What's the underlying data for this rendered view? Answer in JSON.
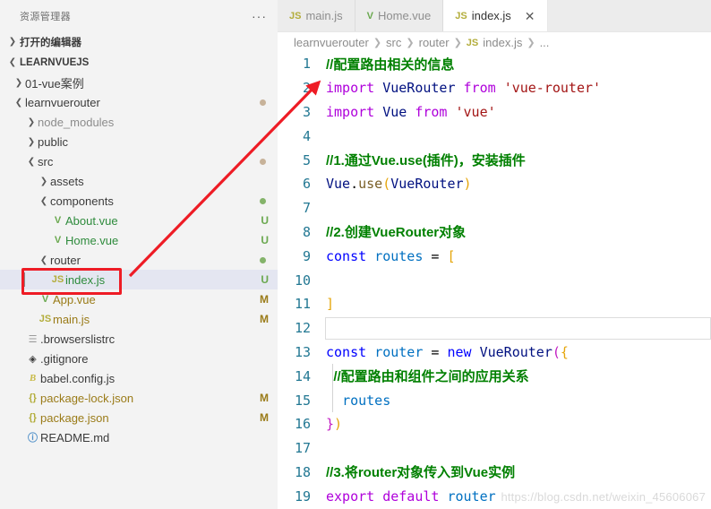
{
  "sidebar": {
    "header_title": "资源管理器",
    "more_actions": "···",
    "open_editors_label": "打开的编辑器",
    "root_label": "LEARNVUEJS",
    "tree": [
      {
        "label": "01-vue案例",
        "depth": 1,
        "type": "folder",
        "expanded": false,
        "color": "plain",
        "status": "",
        "dot": ""
      },
      {
        "label": "learnvuerouter",
        "depth": 1,
        "type": "folder",
        "expanded": true,
        "color": "plain",
        "status": "",
        "dot": "tan"
      },
      {
        "label": "node_modules",
        "depth": 2,
        "type": "folder",
        "expanded": false,
        "color": "grey",
        "status": "",
        "dot": ""
      },
      {
        "label": "public",
        "depth": 2,
        "type": "folder",
        "expanded": false,
        "color": "plain",
        "status": "",
        "dot": ""
      },
      {
        "label": "src",
        "depth": 2,
        "type": "folder",
        "expanded": true,
        "color": "plain",
        "status": "",
        "dot": "tan"
      },
      {
        "label": "assets",
        "depth": 3,
        "type": "folder",
        "expanded": false,
        "color": "plain",
        "status": "",
        "dot": ""
      },
      {
        "label": "components",
        "depth": 3,
        "type": "folder",
        "expanded": true,
        "color": "plain",
        "status": "",
        "dot": "green"
      },
      {
        "label": "About.vue",
        "depth": 4,
        "type": "vue",
        "expanded": null,
        "color": "green",
        "status": "U",
        "dot": ""
      },
      {
        "label": "Home.vue",
        "depth": 4,
        "type": "vue",
        "expanded": null,
        "color": "green",
        "status": "U",
        "dot": ""
      },
      {
        "label": "router",
        "depth": 3,
        "type": "folder",
        "expanded": true,
        "color": "plain",
        "status": "",
        "dot": "green"
      },
      {
        "label": "index.js",
        "depth": 4,
        "type": "js",
        "expanded": null,
        "color": "green",
        "status": "U",
        "dot": "",
        "selected": true
      },
      {
        "label": "App.vue",
        "depth": 3,
        "type": "vue",
        "expanded": null,
        "color": "amber",
        "status": "M",
        "dot": ""
      },
      {
        "label": "main.js",
        "depth": 3,
        "type": "js",
        "expanded": null,
        "color": "amber",
        "status": "M",
        "dot": ""
      },
      {
        "label": ".browserslistrc",
        "depth": 2,
        "type": "list",
        "expanded": null,
        "color": "plain",
        "status": "",
        "dot": ""
      },
      {
        "label": ".gitignore",
        "depth": 2,
        "type": "git",
        "expanded": null,
        "color": "plain",
        "status": "",
        "dot": ""
      },
      {
        "label": "babel.config.js",
        "depth": 2,
        "type": "babel",
        "expanded": null,
        "color": "plain",
        "status": "",
        "dot": ""
      },
      {
        "label": "package-lock.json",
        "depth": 2,
        "type": "json",
        "expanded": null,
        "color": "amber",
        "status": "M",
        "dot": ""
      },
      {
        "label": "package.json",
        "depth": 2,
        "type": "json",
        "expanded": null,
        "color": "amber",
        "status": "M",
        "dot": ""
      },
      {
        "label": "README.md",
        "depth": 2,
        "type": "md",
        "expanded": null,
        "color": "plain",
        "status": "",
        "dot": ""
      }
    ]
  },
  "tabs": [
    {
      "label": "main.js",
      "icon": "js-file-icon",
      "active": false,
      "closable": false
    },
    {
      "label": "Home.vue",
      "icon": "vue-file-icon",
      "active": false,
      "closable": false
    },
    {
      "label": "index.js",
      "icon": "js-file-icon",
      "active": true,
      "closable": true
    }
  ],
  "breadcrumb": {
    "items": [
      "learnvuerouter",
      "src",
      "router",
      "index.js",
      "..."
    ],
    "separator": "❯",
    "file_icon": "js-file-icon"
  },
  "code": {
    "current_line": 12,
    "lines": [
      {
        "n": 1,
        "tokens": [
          {
            "t": "//配置路由相关的信息",
            "c": "t-com"
          }
        ]
      },
      {
        "n": 2,
        "tokens": [
          {
            "t": "import",
            "c": "t-kw"
          },
          {
            "t": " ",
            "c": "t-plain"
          },
          {
            "t": "VueRouter",
            "c": "t-cls"
          },
          {
            "t": " ",
            "c": "t-plain"
          },
          {
            "t": "from",
            "c": "t-kw"
          },
          {
            "t": " ",
            "c": "t-plain"
          },
          {
            "t": "'vue-router'",
            "c": "t-str"
          }
        ]
      },
      {
        "n": 3,
        "tokens": [
          {
            "t": "import",
            "c": "t-kw"
          },
          {
            "t": " ",
            "c": "t-plain"
          },
          {
            "t": "Vue",
            "c": "t-cls"
          },
          {
            "t": " ",
            "c": "t-plain"
          },
          {
            "t": "from",
            "c": "t-kw"
          },
          {
            "t": " ",
            "c": "t-plain"
          },
          {
            "t": "'vue'",
            "c": "t-str"
          }
        ]
      },
      {
        "n": 4,
        "tokens": []
      },
      {
        "n": 5,
        "tokens": [
          {
            "t": "//1.通过Vue.use(插件)，安装插件",
            "c": "t-com"
          }
        ]
      },
      {
        "n": 6,
        "tokens": [
          {
            "t": "Vue",
            "c": "t-cls"
          },
          {
            "t": ".",
            "c": "t-plain"
          },
          {
            "t": "use",
            "c": "t-fn"
          },
          {
            "t": "(",
            "c": "t-brk1"
          },
          {
            "t": "VueRouter",
            "c": "t-cls"
          },
          {
            "t": ")",
            "c": "t-brk1"
          }
        ]
      },
      {
        "n": 7,
        "tokens": []
      },
      {
        "n": 8,
        "tokens": [
          {
            "t": "//2.创建VueRouter对象",
            "c": "t-com"
          }
        ]
      },
      {
        "n": 9,
        "tokens": [
          {
            "t": "const",
            "c": "t-kw2"
          },
          {
            "t": " ",
            "c": "t-plain"
          },
          {
            "t": "routes",
            "c": "t-var"
          },
          {
            "t": " ",
            "c": "t-plain"
          },
          {
            "t": "=",
            "c": "t-op"
          },
          {
            "t": " ",
            "c": "t-plain"
          },
          {
            "t": "[",
            "c": "t-brk1"
          }
        ]
      },
      {
        "n": 10,
        "tokens": []
      },
      {
        "n": 11,
        "tokens": [
          {
            "t": "]",
            "c": "t-brk1"
          }
        ]
      },
      {
        "n": 12,
        "tokens": []
      },
      {
        "n": 13,
        "tokens": [
          {
            "t": "const",
            "c": "t-kw2"
          },
          {
            "t": " ",
            "c": "t-plain"
          },
          {
            "t": "router",
            "c": "t-var"
          },
          {
            "t": " ",
            "c": "t-plain"
          },
          {
            "t": "=",
            "c": "t-op"
          },
          {
            "t": " ",
            "c": "t-plain"
          },
          {
            "t": "new",
            "c": "t-kw2"
          },
          {
            "t": " ",
            "c": "t-plain"
          },
          {
            "t": "VueRouter",
            "c": "t-cls"
          },
          {
            "t": "(",
            "c": "t-brk2"
          },
          {
            "t": "{",
            "c": "t-brk1"
          }
        ]
      },
      {
        "n": 14,
        "indent": true,
        "tokens": [
          {
            "t": "  //配置路由和组件之间的应用关系",
            "c": "t-com"
          }
        ]
      },
      {
        "n": 15,
        "indent": true,
        "tokens": [
          {
            "t": "  ",
            "c": "t-plain"
          },
          {
            "t": "routes",
            "c": "t-var"
          }
        ]
      },
      {
        "n": 16,
        "tokens": [
          {
            "t": "}",
            "c": "t-brk2"
          },
          {
            "t": ")",
            "c": "t-brk1"
          }
        ]
      },
      {
        "n": 17,
        "tokens": []
      },
      {
        "n": 18,
        "tokens": [
          {
            "t": "//3.将router对象传入到Vue实例",
            "c": "t-com"
          }
        ]
      },
      {
        "n": 19,
        "tokens": [
          {
            "t": "export",
            "c": "t-kw"
          },
          {
            "t": " ",
            "c": "t-plain"
          },
          {
            "t": "default",
            "c": "t-kw"
          },
          {
            "t": " ",
            "c": "t-plain"
          },
          {
            "t": "router",
            "c": "t-var"
          }
        ]
      }
    ]
  },
  "annotation": {
    "highlight_color": "#ee1c25",
    "arrow_color": "#ee1c25",
    "highlight_target": "index.js",
    "arrow_from": "index.js sidebar entry",
    "arrow_to": "line 2 import VueRouter"
  },
  "watermark": "https://blog.csdn.net/weixin_45606067"
}
